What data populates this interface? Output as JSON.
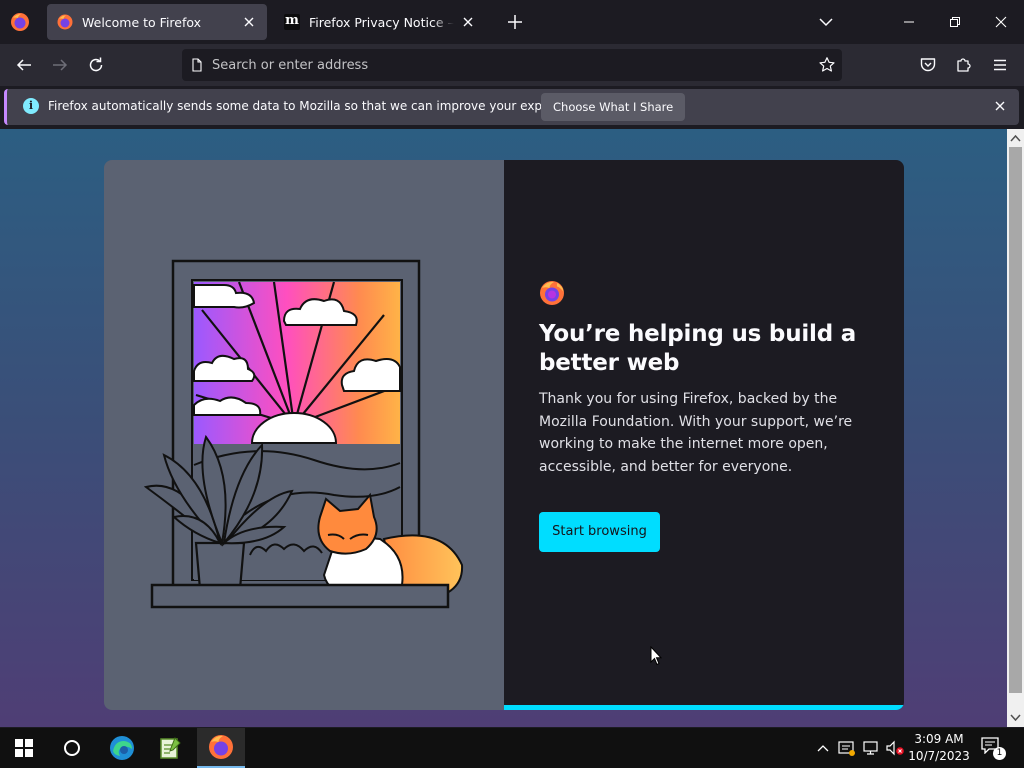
{
  "browser": {
    "tabs": [
      {
        "title": "Welcome to Firefox",
        "active": true
      },
      {
        "title": "Firefox Privacy Notice — Mozilla",
        "active": false
      }
    ]
  },
  "navbar": {
    "address_placeholder": "Search or enter address"
  },
  "notification": {
    "message": "Firefox automatically sends some data to Mozilla so that we can improve your experience.",
    "button_label": "Choose What I Share"
  },
  "welcome": {
    "heading": "You’re helping us build a better web",
    "body": "Thank you for using Firefox, backed by the Mozilla Foundation. With your support, we’re working to make the internet more open, accessible, and better for everyone.",
    "cta_label": "Start browsing",
    "progress": 1.0
  },
  "taskbar": {
    "time": "3:09 AM",
    "date": "10/7/2023",
    "notification_count": "1"
  },
  "colors": {
    "accent": "#00ddff",
    "notification_stripe": "#c689ff",
    "content_bg_top": "#2c5e82",
    "content_bg_bottom": "#4f3e75"
  }
}
